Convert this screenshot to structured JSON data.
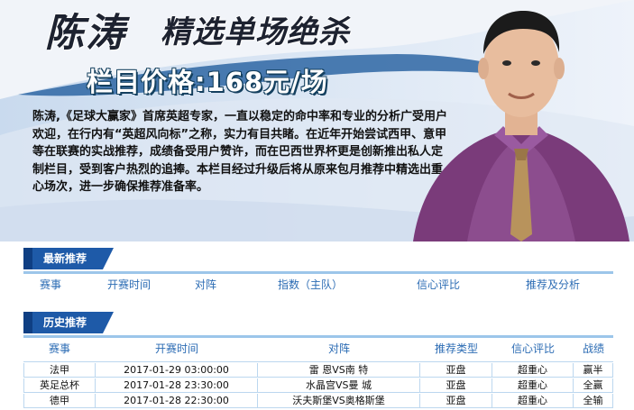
{
  "banner": {
    "name": "陈涛",
    "subtitle": "精选单场绝杀",
    "price": "栏目价格:168元/场",
    "intro": "陈涛,《足球大赢家》首席英超专家，一直以稳定的命中率和专业的分析广受用户欢迎，在行内有“英超风向标”之称，实力有目共睹。在近年开始尝试西甲、意甲等在联赛的实战推荐，成绩备受用户赞许，而在巴西世界杯更是创新推出私人定制栏目，受到客户热烈的追捧。本栏目经过升级后将从原来包月推荐中精选出重心场次，进一步确保推荐准备率。"
  },
  "latest": {
    "tab": "最新推荐",
    "columns": [
      "赛事",
      "开赛时间",
      "对阵",
      "指数（主队）",
      "信心评比",
      "推荐及分析"
    ]
  },
  "history": {
    "tab": "历史推荐",
    "columns": [
      "赛事",
      "开赛时间",
      "对阵",
      "推荐类型",
      "信心评比",
      "战绩"
    ],
    "rows": [
      [
        "法甲",
        "2017-01-29 03:00:00",
        "雷 恩VS南 特",
        "亚盘",
        "超重心",
        "赢半"
      ],
      [
        "英足总杯",
        "2017-01-28 23:30:00",
        "水晶宫VS曼 城",
        "亚盘",
        "超重心",
        "全赢"
      ],
      [
        "德甲",
        "2017-01-28 22:30:00",
        "沃夫斯堡VS奥格斯堡",
        "亚盘",
        "超重心",
        "全输"
      ]
    ]
  },
  "colors": {
    "accent": "#1e5aa8",
    "header_text": "#2c6cb4",
    "border": "#bcd7ef"
  }
}
